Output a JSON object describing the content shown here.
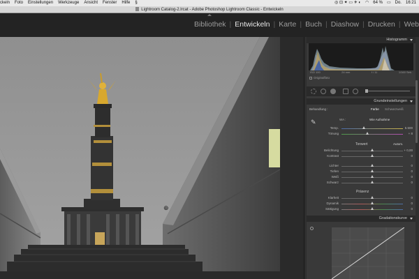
{
  "menubar": {
    "items": [
      "ckeln",
      "Foto",
      "Einstellungen",
      "Werkzeuge",
      "Ansicht",
      "Fenster",
      "Hilfe"
    ],
    "battery": "64 %",
    "day": "Do.",
    "time": "16:21"
  },
  "titlebar": {
    "title": "Lightroom Catalog-2.lrcat - Adobe Photoshop Lightroom Classic - Entwickeln"
  },
  "modules": [
    {
      "label": "Bibliothek",
      "active": false
    },
    {
      "label": "Entwickeln",
      "active": true
    },
    {
      "label": "Karte",
      "active": false
    },
    {
      "label": "Buch",
      "active": false
    },
    {
      "label": "Diashow",
      "active": false
    },
    {
      "label": "Drucken",
      "active": false
    },
    {
      "label": "Web",
      "active": false
    }
  ],
  "panel": {
    "histogram": {
      "title": "Histogramm",
      "exif": [
        "ISO 100",
        "24 mm",
        "f / 11",
        "1/160 Sek."
      ],
      "original_label": "Originalfoto"
    },
    "basic": {
      "title": "Grundeinstellungen",
      "treatment_label": "Behandlung :",
      "color_btn": "Farbe",
      "bw_btn": "Schwarzweiß",
      "wb_label": "WA :",
      "wb_value": "Wie Aufnahme",
      "temp_label": "Temp.",
      "temp_value": "5.500",
      "tint_label": "Tönung",
      "tint_value": "+ 8",
      "tone_group": "Tonwert",
      "auto_btn": "Autom.",
      "exposure_label": "Belichtung",
      "exposure_value": "+ 0,00",
      "contrast_label": "Kontrast",
      "contrast_value": "0",
      "highlights_label": "Lichter",
      "highlights_value": "0",
      "shadows_label": "Tiefen",
      "shadows_value": "0",
      "whites_label": "Weiß",
      "whites_value": "0",
      "blacks_label": "Schwarz",
      "blacks_value": "0",
      "presence_group": "Präsenz",
      "clarity_label": "Klarheit",
      "clarity_value": "0",
      "vibrance_label": "Dynamik",
      "vibrance_value": "0",
      "saturation_label": "Sättigung",
      "saturation_value": "0"
    },
    "curve": {
      "title": "Gradationskurve"
    }
  },
  "colors": {
    "accent": "#e8e8e8",
    "panel_bg": "#393939",
    "header_bg": "#2a2a2a"
  }
}
